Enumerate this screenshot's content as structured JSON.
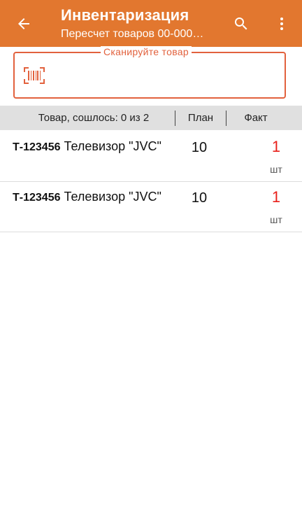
{
  "appbar": {
    "title": "Инвентаризация",
    "subtitle": "Пересчет товаров 00-000…",
    "background": "#e2772f"
  },
  "scan": {
    "label": "Сканируйте товар",
    "value": "",
    "accent": "#e2613d",
    "icon": "barcode-icon"
  },
  "table": {
    "columns": {
      "goods": "Товар, сошлось: 0 из 2",
      "plan": "План",
      "fact": "Факт"
    },
    "rows": [
      {
        "code": "Т-123456",
        "name": "Телевизор \"JVC\"",
        "plan": "10",
        "fact": "1",
        "unit": "шт"
      },
      {
        "code": "Т-123456",
        "name": "Телевизор \"JVC\"",
        "plan": "10",
        "fact": "1",
        "unit": "шт"
      }
    ]
  },
  "colors": {
    "fact_mismatch": "#e8201b",
    "header_bg": "#e0e0e0"
  }
}
